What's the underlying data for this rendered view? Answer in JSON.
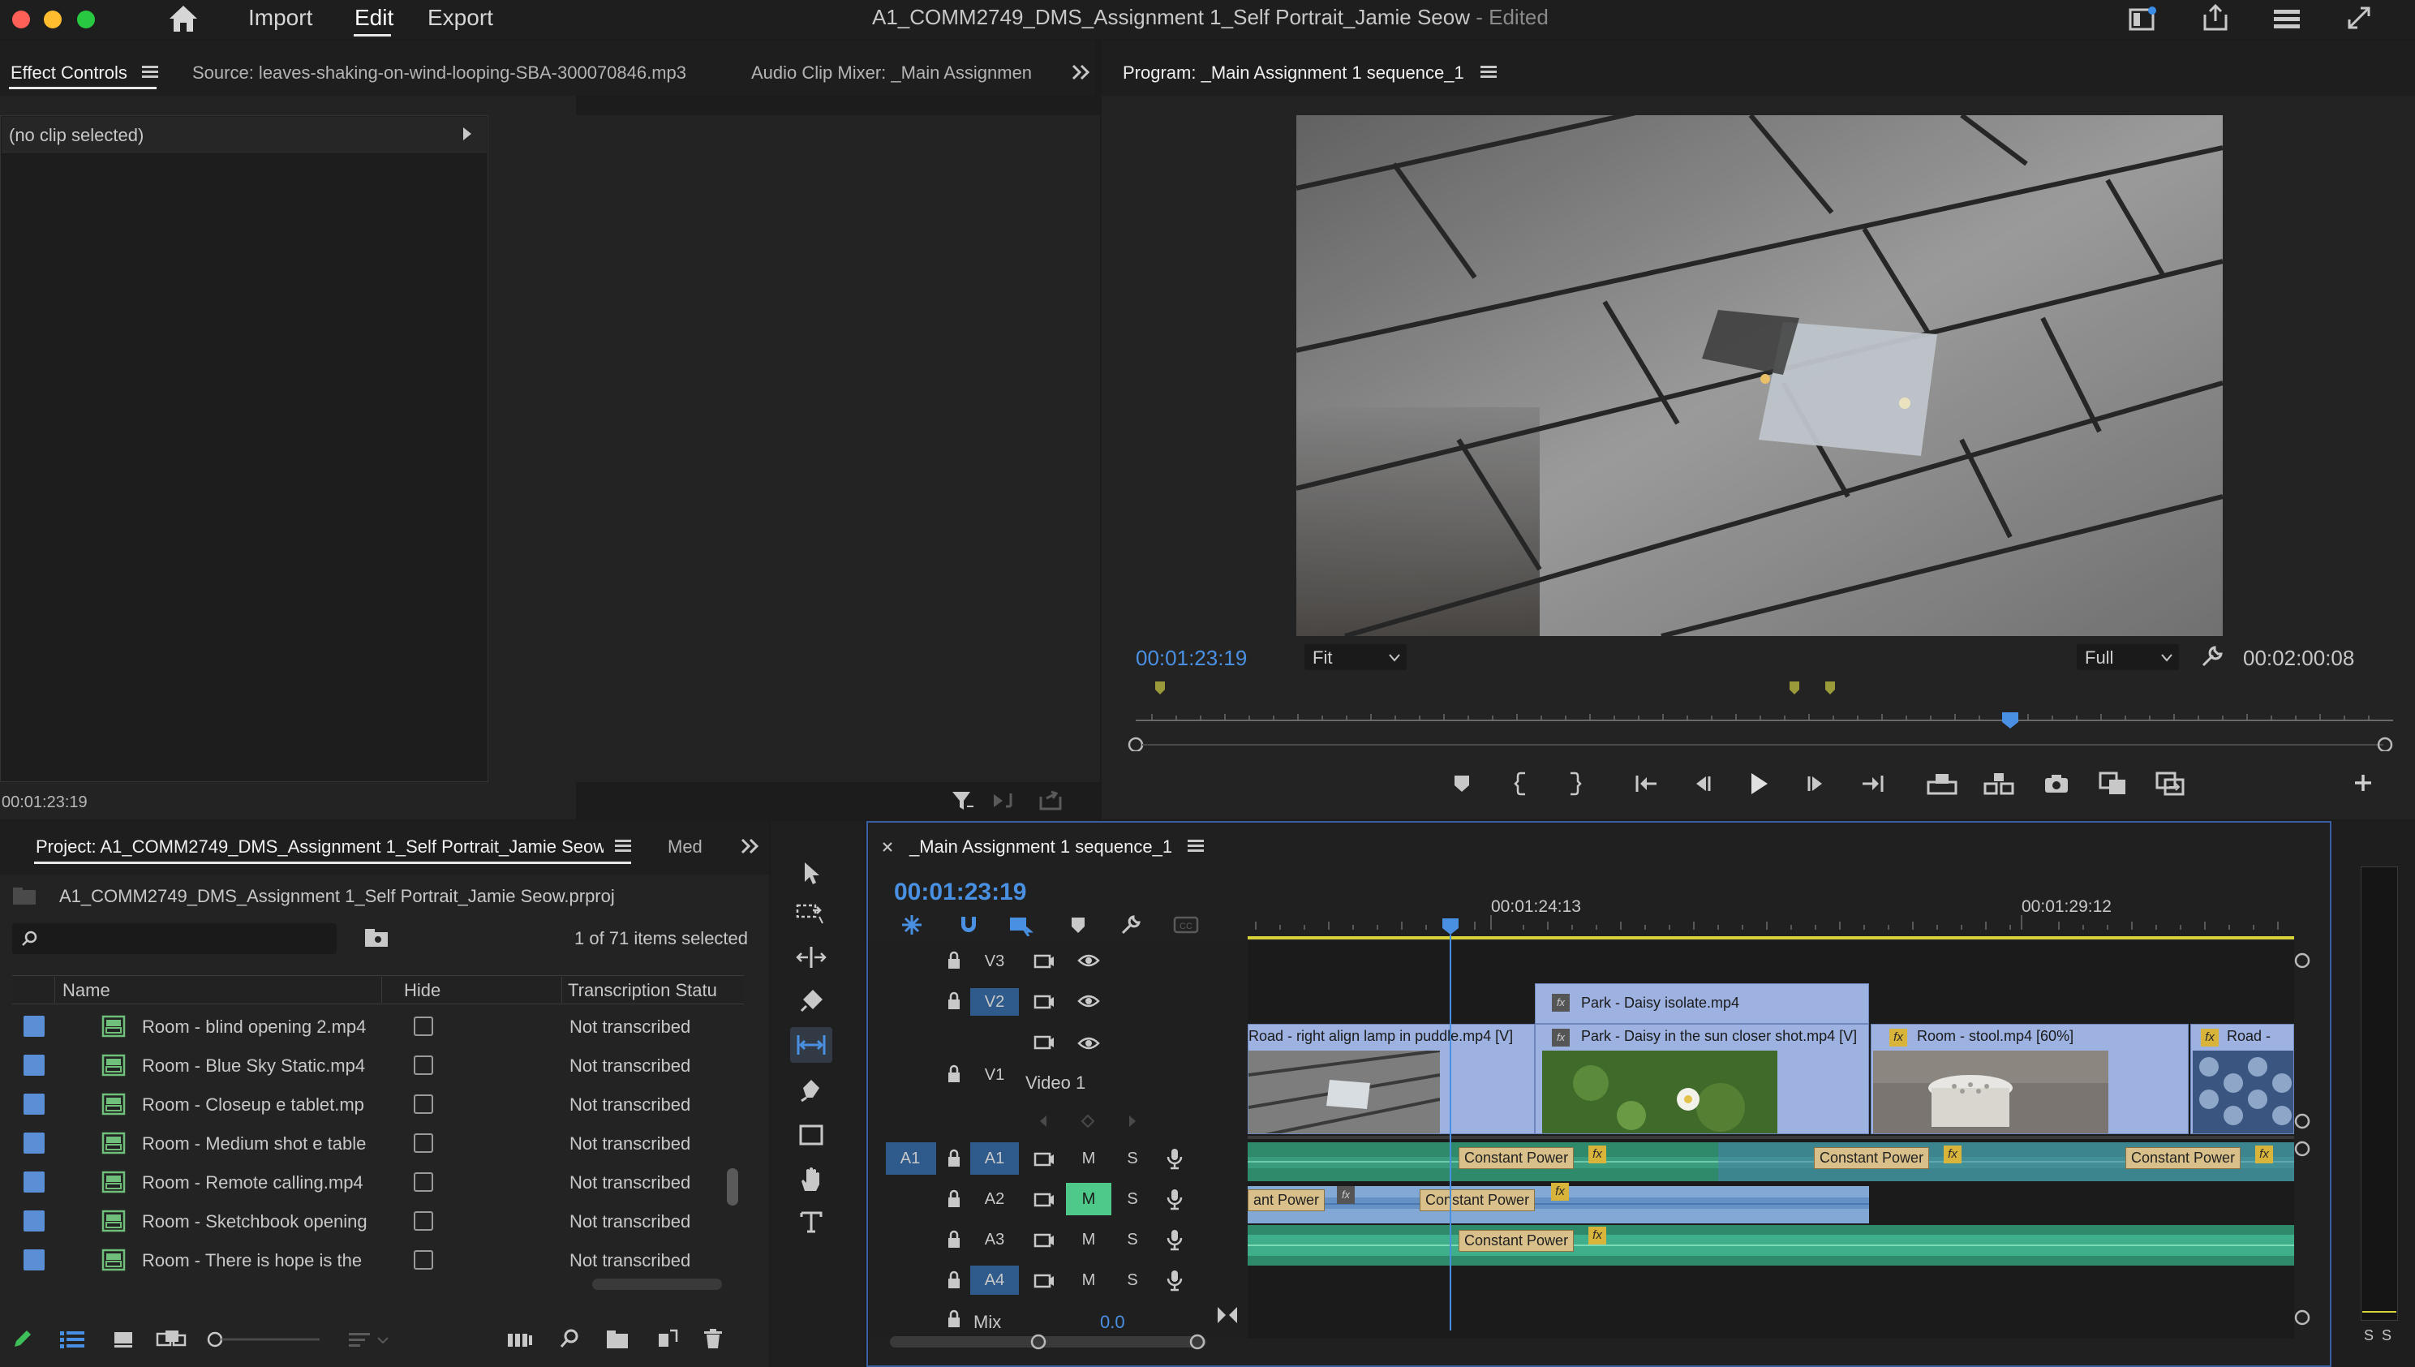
{
  "app": {
    "title": "A1_COMM2749_DMS_Assignment 1_Self Portrait_Jamie Seow",
    "status": "- Edited",
    "menu": [
      "Import",
      "Edit",
      "Export"
    ]
  },
  "top_left_panel": {
    "tabs": [
      "Effect Controls",
      "Source: leaves-shaking-on-wind-looping-SBA-300070846.mp3",
      "Audio Clip Mixer: _Main Assignmen"
    ],
    "no_clip": "(no clip selected)",
    "timecode": "00:01:23:19"
  },
  "program": {
    "tab": "Program: _Main Assignment 1 sequence_1",
    "timecode": "00:01:23:19",
    "fit": "Fit",
    "quality": "Full",
    "duration": "00:02:00:08"
  },
  "project": {
    "tab": "Project: A1_COMM2749_DMS_Assignment 1_Self Portrait_Jamie Seow",
    "tab2": "Med",
    "file": "A1_COMM2749_DMS_Assignment 1_Self Portrait_Jamie Seow.prproj",
    "selection": "1 of 71 items selected",
    "search_placeholder": "",
    "columns": [
      "Name",
      "Hide",
      "Transcription Statu"
    ],
    "items": [
      {
        "name": "Room - blind opening 2.mp4",
        "status": "Not transcribed"
      },
      {
        "name": "Room - Blue Sky Static.mp4",
        "status": "Not transcribed"
      },
      {
        "name": "Room - Closeup e tablet.mp",
        "status": "Not transcribed"
      },
      {
        "name": "Room - Medium shot e table",
        "status": "Not transcribed"
      },
      {
        "name": "Room - Remote calling.mp4",
        "status": "Not transcribed"
      },
      {
        "name": "Room - Sketchbook opening",
        "status": "Not transcribed"
      },
      {
        "name": "Room - There is hope is the",
        "status": "Not transcribed"
      }
    ]
  },
  "timeline": {
    "tab": "_Main Assignment 1 sequence_1",
    "timecode": "00:01:23:19",
    "ruler": [
      "00:01:24:13",
      "00:01:29:12"
    ],
    "video_tracks": [
      "V3",
      "V2",
      "V1"
    ],
    "video1_name": "Video 1",
    "audio_tracks": [
      "A1",
      "A2",
      "A3",
      "A4"
    ],
    "source_patch_v": "V1",
    "source_patch_a": "A1",
    "mute": "M",
    "solo": "S",
    "mix_label": "Mix",
    "mix_value": "0.0",
    "fx": "fx",
    "clips": {
      "v2": "Park - Daisy isolate.mp4",
      "v1_a": "Road - right align lamp in puddle.mp4 [V]",
      "v1_b": "Park - Daisy in the sun closer shot.mp4 [V]",
      "v1_c": "Room - stool.mp4 [60%]",
      "v1_d": "Road -"
    },
    "transitions": {
      "cp": "Constant Power",
      "cp_partial": "ant Power"
    }
  },
  "meter": {
    "labels": [
      "S",
      "S"
    ]
  },
  "colors": {
    "accent": "#4a90e2",
    "video_clip": "#9db2e0",
    "audio_clip": "#2f8a6c",
    "playhead": "#4a90e2",
    "work_area": "#d8d23a"
  }
}
